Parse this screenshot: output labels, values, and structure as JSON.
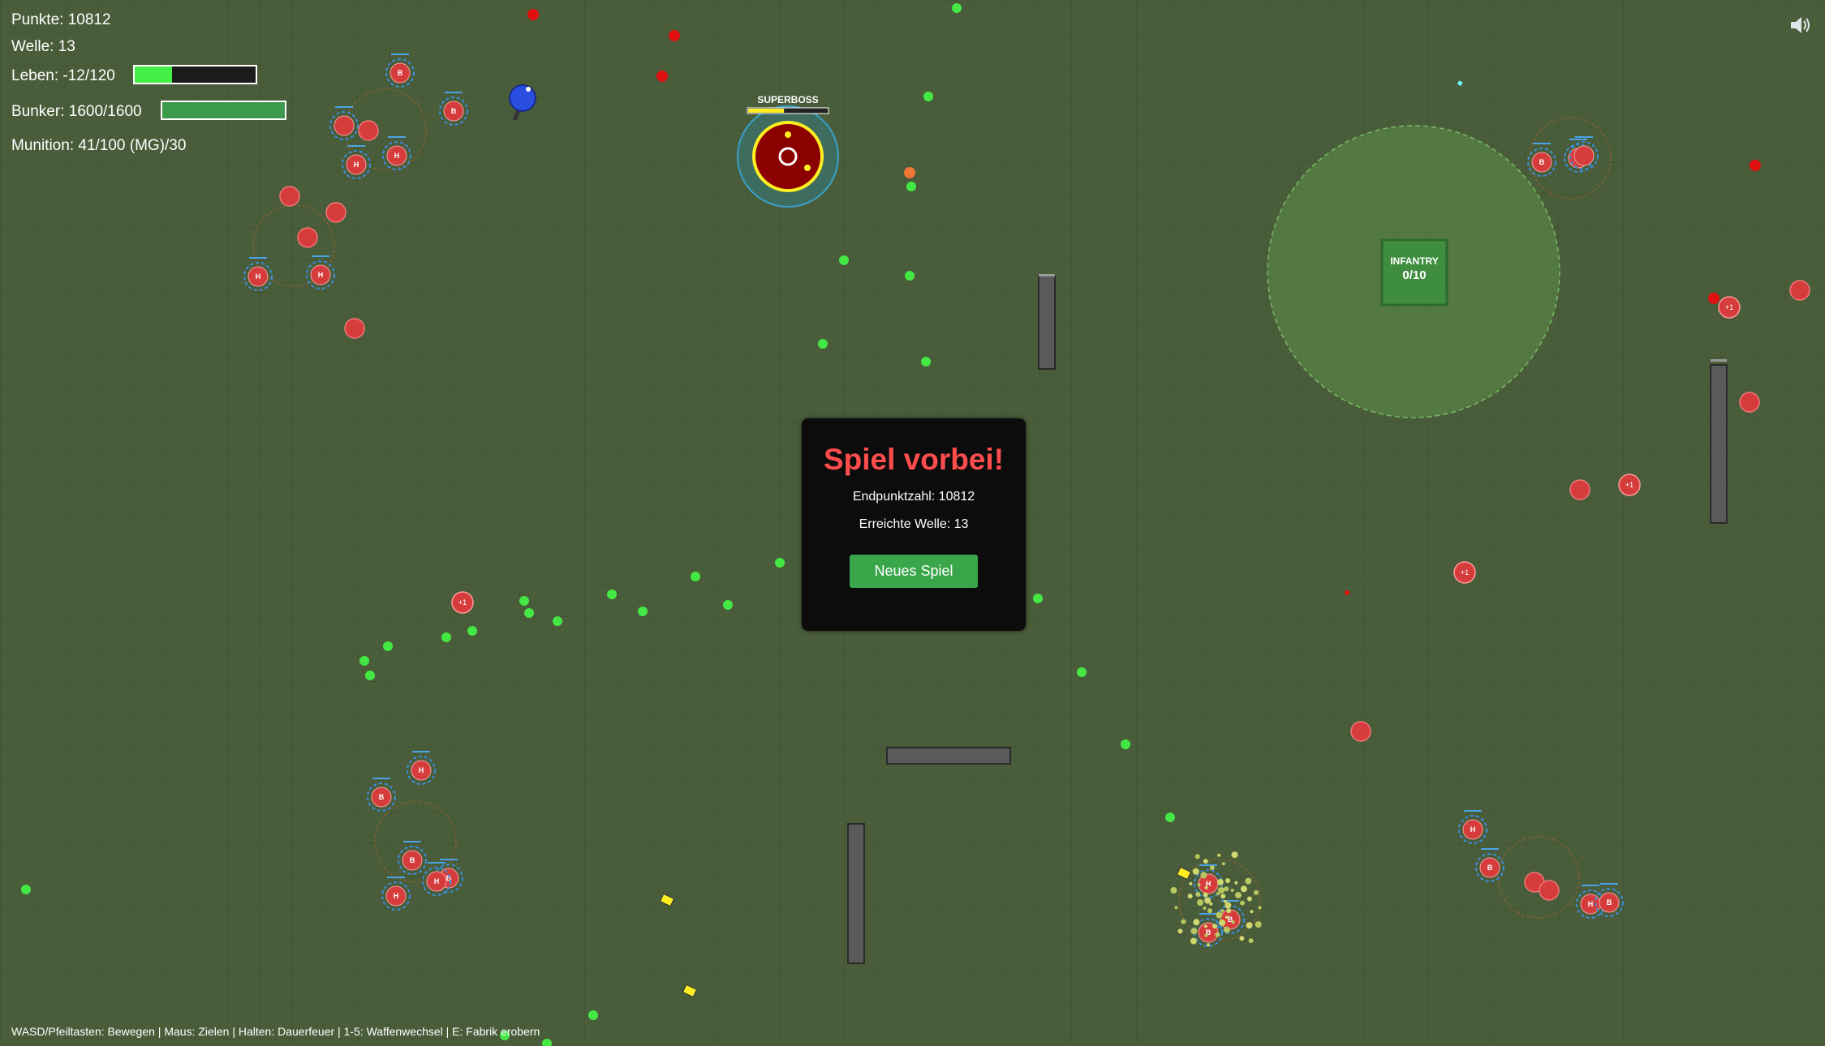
{
  "hud": {
    "score_label": "Punkte: 10812",
    "wave_label": "Welle: 13",
    "life_label": "Leben: -12/120",
    "life_fraction": 0.31,
    "bunker_label": "Bunker: 1600/1600",
    "bunker_fraction": 1.0,
    "ammo_label": "Munition: 41/100 (MG)/30"
  },
  "boss": {
    "label": "SUPERBOSS",
    "health_fraction": 0.45
  },
  "factory": {
    "type_label": "INFANTRY",
    "count_label": "0/10"
  },
  "enemy_labels": {
    "heavy": "H",
    "bomber": "B",
    "bonus": "+1"
  },
  "game_over": {
    "title": "Spiel vorbei!",
    "final_score": "Endpunktzahl: 10812",
    "reached_wave": "Erreichte Welle: 13",
    "new_game_button": "Neues Spiel"
  },
  "help_text": "WASD/Pfeiltasten: Bewegen | Maus: Zielen | Halten: Dauerfeuer | 1-5: Waffenwechsel | E: Fabrik erobern",
  "icons": {
    "sound": "speaker-icon"
  },
  "colors": {
    "grass": "#4a5d3a",
    "life_fill": "#44ee44",
    "bunker_fill": "#3c9a4c",
    "enemy": "#d63c3c",
    "pickup": "#44e844",
    "title_red": "#ff4d4d",
    "button_green": "#3aa64a"
  }
}
